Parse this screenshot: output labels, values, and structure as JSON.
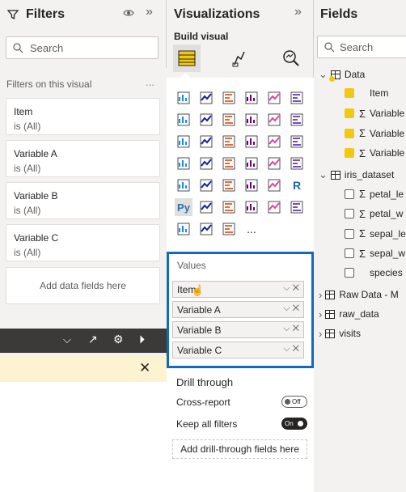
{
  "filters": {
    "title": "Filters",
    "search_placeholder": "Search",
    "section_label": "Filters on this visual",
    "more": "...",
    "cards": [
      {
        "name": "Item",
        "state": "is (All)"
      },
      {
        "name": "Variable A",
        "state": "is (All)"
      },
      {
        "name": "Variable B",
        "state": "is (All)"
      },
      {
        "name": "Variable C",
        "state": "is (All)"
      }
    ],
    "add_label": "Add data fields here"
  },
  "visualizations": {
    "title": "Visualizations",
    "build_visual": "Build visual",
    "values_label": "Values",
    "values": [
      "Item",
      "Variable A",
      "Variable B",
      "Variable C"
    ],
    "drill_through": "Drill through",
    "cross_report": "Cross-report",
    "cross_report_state": "Off",
    "keep_all_filters": "Keep all filters",
    "keep_all_filters_state": "On",
    "add_drill": "Add drill-through fields here",
    "more_visuals": "..."
  },
  "fields": {
    "title": "Fields",
    "search_placeholder": "Search",
    "tables": [
      {
        "name": "Data",
        "expanded": true,
        "fields": [
          {
            "name": "Item",
            "sigma": false,
            "checked": true
          },
          {
            "name": "Variable",
            "sigma": true,
            "checked": true
          },
          {
            "name": "Variable",
            "sigma": true,
            "checked": true
          },
          {
            "name": "Variable",
            "sigma": true,
            "checked": true
          }
        ]
      },
      {
        "name": "iris_dataset",
        "expanded": true,
        "fields": [
          {
            "name": "petal_le",
            "sigma": true,
            "checked": false
          },
          {
            "name": "petal_w",
            "sigma": true,
            "checked": false
          },
          {
            "name": "sepal_le",
            "sigma": true,
            "checked": false
          },
          {
            "name": "sepal_w",
            "sigma": true,
            "checked": false
          },
          {
            "name": "species",
            "sigma": false,
            "checked": false
          }
        ]
      },
      {
        "name": "Raw Data - M",
        "expanded": false,
        "fields": []
      },
      {
        "name": "raw_data",
        "expanded": false,
        "fields": []
      },
      {
        "name": "visits",
        "expanded": false,
        "fields": []
      }
    ]
  },
  "colors": {
    "accent": "#0f6cbd",
    "powerbi_yellow": "#f2c811",
    "dark_bar": "#3b3a39"
  }
}
